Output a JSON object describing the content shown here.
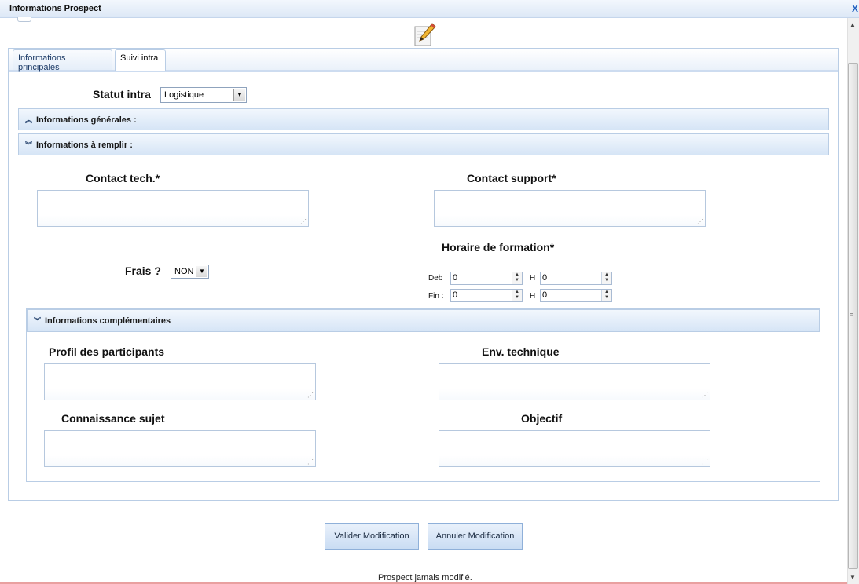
{
  "window": {
    "title": "Informations Prospect",
    "close_label": "X"
  },
  "tabs": [
    {
      "label": "Informations principales",
      "active": false
    },
    {
      "label": "Suivi intra",
      "active": true
    }
  ],
  "statut": {
    "label": "Statut intra",
    "value": "Logistique"
  },
  "sections": {
    "generales": {
      "label": "Informations générales :",
      "expanded": false
    },
    "remplir": {
      "label": "Informations à remplir :",
      "expanded": true
    },
    "complementaires": {
      "label": "Informations complémentaires",
      "expanded": true
    }
  },
  "fields": {
    "contact_tech": "Contact tech.*",
    "contact_support": "Contact support*",
    "horaire": "Horaire de formation*",
    "frais_label": "Frais ?",
    "frais_value": "NON",
    "profil": "Profil des participants",
    "env": "Env. technique",
    "connaissance": "Connaissance sujet",
    "objectif": "Objectif"
  },
  "horaire": {
    "deb_label": "Deb :",
    "fin_label": "Fin :",
    "h_label": "H",
    "deb_start": "0",
    "deb_end": "0",
    "fin_start": "0",
    "fin_end": "0"
  },
  "buttons": {
    "validate": "Valider Modification",
    "cancel": "Annuler Modification"
  },
  "status": "Prospect jamais modifié.",
  "icons": {
    "edit": "pencil-paper-icon"
  },
  "colors": {
    "accent": "#1f5fbf",
    "section_bg": "#d6e5f6",
    "border": "#b9cde5"
  }
}
